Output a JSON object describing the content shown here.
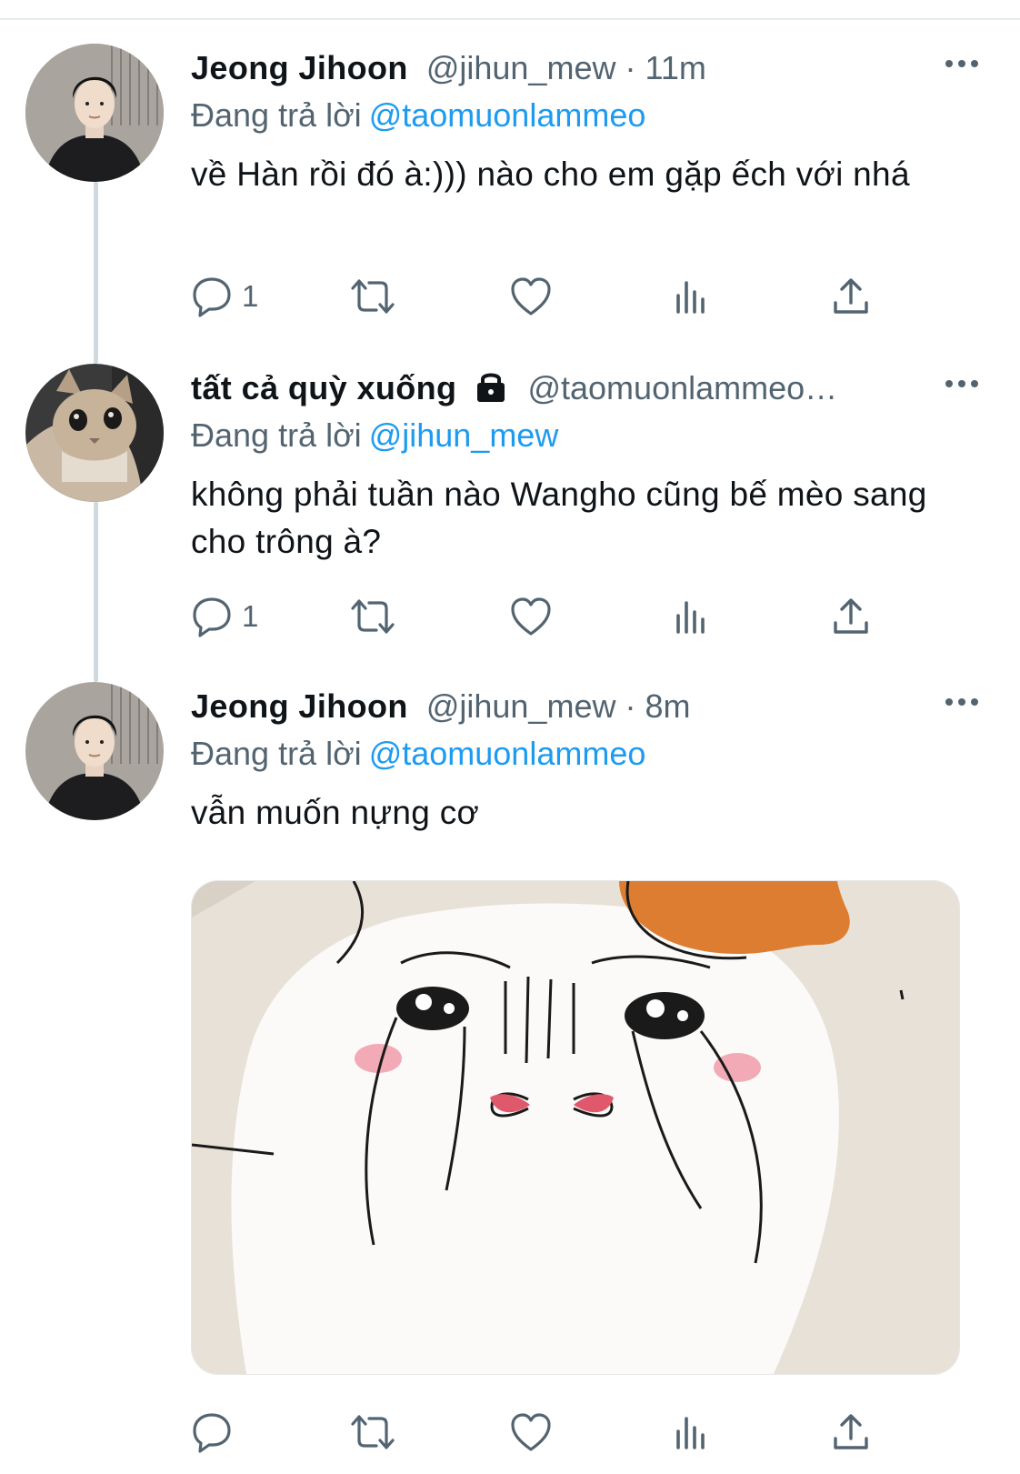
{
  "tweets": [
    {
      "name": "Jeong Jihoon",
      "handle": "@jihun_mew",
      "separator": "·",
      "time": "11m",
      "replying_label": "Đang trả lời",
      "replying_to": "@taomuonlammeo",
      "text": "về Hàn rồi đó à:))) nào cho em gặp ếch với nhá",
      "reply_count": "1"
    },
    {
      "name": "tất cả quỳ xuống",
      "handle": "@taomuonlammeo…",
      "locked": true,
      "replying_label": "Đang trả lời",
      "replying_to": "@jihun_mew",
      "text": "không phải tuần nào Wangho cũng bế mèo sang cho trông à?",
      "reply_count": "1"
    },
    {
      "name": "Jeong Jihoon",
      "handle": "@jihun_mew",
      "separator": "·",
      "time": "8m",
      "replying_label": "Đang trả lời",
      "replying_to": "@taomuonlammeo",
      "text": "vẫn muốn nựng cơ",
      "has_media": true
    }
  ],
  "icons": {
    "more": "more-icon",
    "reply": "reply-icon",
    "retweet": "retweet-icon",
    "like": "like-icon",
    "views": "views-icon",
    "share": "share-icon",
    "lock": "lock-icon"
  },
  "colors": {
    "text": "#0f1419",
    "muted": "#536471",
    "link": "#1d9bf0",
    "thread_line": "#cfd9de"
  }
}
